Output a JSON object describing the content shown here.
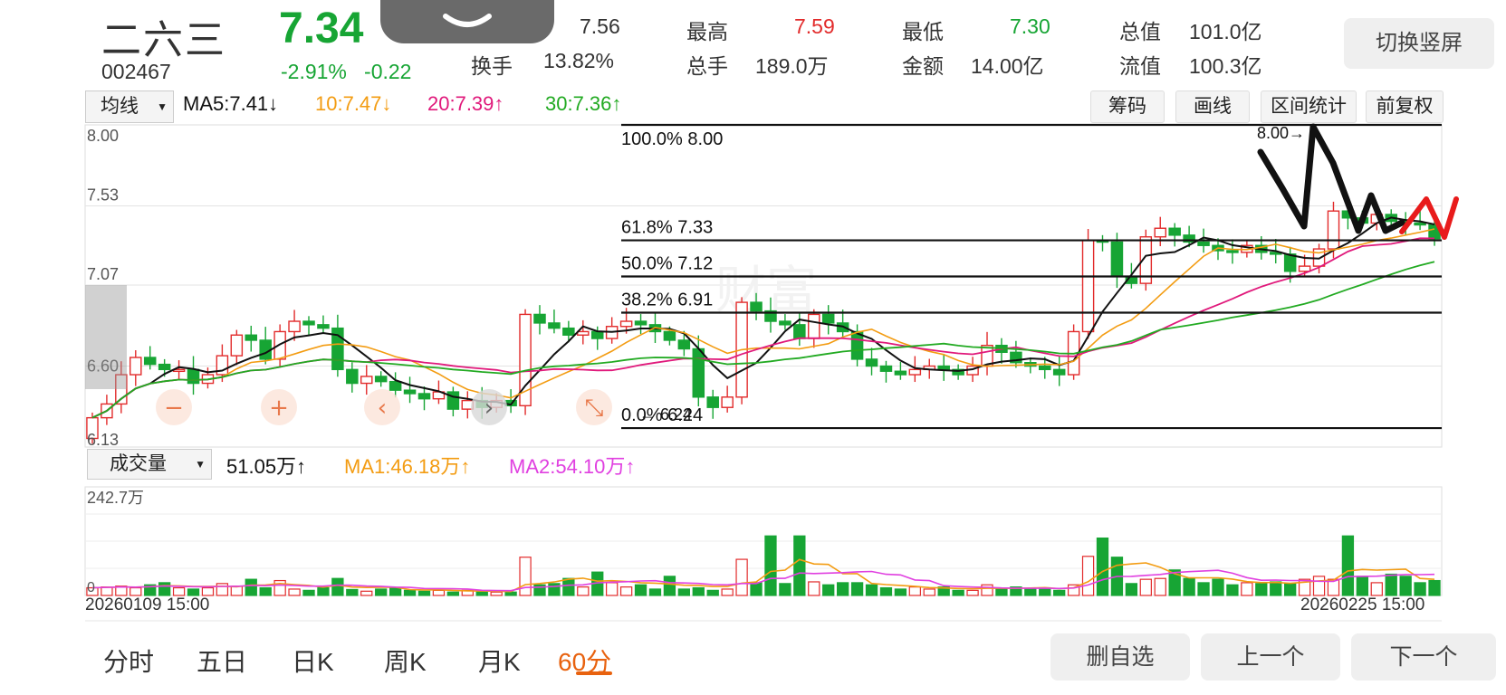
{
  "stock": {
    "name": "二六三",
    "code": "002467",
    "price": "7.34",
    "change_pct": "-2.91%",
    "change_abs": "-0.22"
  },
  "quote": {
    "open": "7.56",
    "high_label": "最高",
    "high": "7.59",
    "low_label": "最低",
    "low": "7.30",
    "mktcap_label": "总值",
    "mktcap": "101.0亿",
    "turnover_label": "换手",
    "turnover": "13.82%",
    "volume_label": "总手",
    "volume": "189.0万",
    "amount_label": "金额",
    "amount": "14.00亿",
    "float_label": "流值",
    "float": "100.3亿"
  },
  "buttons": {
    "switch_orientation": "切换竖屏",
    "chips": "筹码",
    "draw": "画线",
    "range_stats": "区间统计",
    "adjust": "前复权"
  },
  "ma_bar": {
    "select": "均线",
    "ma5": "MA5:7.41↓",
    "ma10": "10:7.47↓",
    "ma20": "20:7.39↑",
    "ma30": "30:7.36↑"
  },
  "price_axis": {
    "top": "8.00",
    "l2": "7.53",
    "l3": "7.07",
    "l4": "6.60",
    "bottom": "6.13"
  },
  "fib": [
    {
      "pct": "100.0%",
      "price": "8.00",
      "level": 8.0
    },
    {
      "pct": "61.8%",
      "price": "7.33",
      "level": 7.33
    },
    {
      "pct": "50.0%",
      "price": "7.12",
      "level": 7.12
    },
    {
      "pct": "38.2%",
      "price": "6.91",
      "level": 6.91
    },
    {
      "pct": "0.0%",
      "price": "6.24",
      "level": 6.24
    }
  ],
  "annotations": {
    "max": "8.00→",
    "min": "← 6.24"
  },
  "vol_bar": {
    "select": "成交量",
    "vol": "51.05万↑",
    "ma1": "MA1:46.18万↑",
    "ma2": "MA2:54.10万↑"
  },
  "vol_axis": {
    "top": "242.7万",
    "bottom": "0"
  },
  "dates": {
    "start": "20260109 15:00",
    "end": "20260225 15:00"
  },
  "tabs": [
    "分时",
    "五日",
    "日K",
    "周K",
    "月K",
    "60分"
  ],
  "active_tab": "60分",
  "bottom_buttons": {
    "remove": "删自选",
    "prev": "上一个",
    "next": "下一个"
  },
  "chart_data": {
    "type": "candlestick",
    "colors": {
      "up": "#e22b2b",
      "down": "#17a534",
      "ma5": "#111111",
      "ma10": "#f39c12",
      "ma20": "#e0197b",
      "ma30": "#22aa22",
      "vol_ma1": "#f39c12",
      "vol_ma2": "#e040e0"
    },
    "ylim": [
      6.13,
      8.0
    ],
    "close": [
      6.3,
      6.38,
      6.55,
      6.65,
      6.61,
      6.58,
      6.58,
      6.5,
      6.55,
      6.66,
      6.78,
      6.75,
      6.64,
      6.8,
      6.86,
      6.84,
      6.82,
      6.58,
      6.5,
      6.54,
      6.51,
      6.46,
      6.44,
      6.41,
      6.45,
      6.35,
      6.4,
      6.36,
      6.4,
      6.37,
      6.9,
      6.85,
      6.82,
      6.78,
      6.8,
      6.76,
      6.83,
      6.86,
      6.84,
      6.8,
      6.75,
      6.7,
      6.42,
      6.36,
      6.42,
      6.97,
      6.92,
      6.86,
      6.84,
      6.76,
      6.9,
      6.85,
      6.8,
      6.64,
      6.6,
      6.57,
      6.55,
      6.58,
      6.6,
      6.58,
      6.55,
      6.6,
      6.72,
      6.68,
      6.62,
      6.6,
      6.58,
      6.55,
      6.8,
      7.33,
      7.32,
      7.12,
      7.08,
      7.35,
      7.4,
      7.36,
      7.32,
      7.3,
      7.27,
      7.26,
      7.3,
      7.26,
      7.25,
      7.15,
      7.18,
      7.28,
      7.5,
      7.46,
      7.43,
      7.48,
      7.44,
      7.43,
      7.42,
      7.34
    ],
    "volume": [
      18,
      20,
      22,
      18,
      25,
      30,
      18,
      15,
      18,
      28,
      22,
      38,
      18,
      35,
      15,
      12,
      18,
      40,
      14,
      10,
      15,
      18,
      12,
      10,
      12,
      8,
      12,
      10,
      8,
      8,
      90,
      25,
      28,
      40,
      20,
      55,
      30,
      20,
      25,
      15,
      45,
      15,
      18,
      12,
      15,
      85,
      30,
      140,
      28,
      140,
      32,
      25,
      30,
      30,
      25,
      18,
      15,
      20,
      15,
      20,
      12,
      12,
      25,
      15,
      20,
      15,
      18,
      12,
      25,
      92,
      135,
      90,
      28,
      38,
      40,
      60,
      40,
      30,
      38,
      25,
      30,
      28,
      32,
      28,
      38,
      45,
      38,
      140,
      45,
      30,
      50,
      45,
      30,
      35
    ]
  }
}
